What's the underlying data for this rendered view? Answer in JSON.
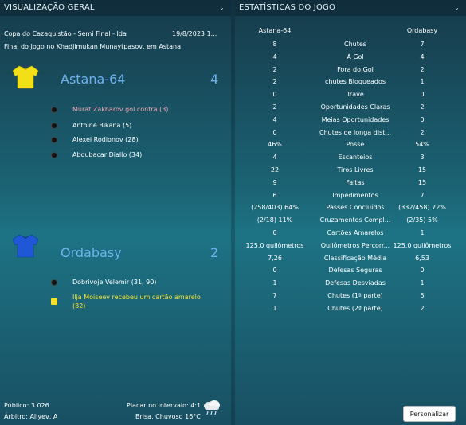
{
  "headers": {
    "overview": "VISUALIZAÇÃO GERAL",
    "stats": "ESTATÍSTICAS DO JOGO"
  },
  "match": {
    "competition": "Copa do Cazaquistão - Semi Final - Ida",
    "date": "19/8/2023 1...",
    "venue": "Final do Jogo no Khadjimukan Munaytpasov, em Astana"
  },
  "home": {
    "name": "Astana-64",
    "score": "4",
    "shirt_color": "#f2df17",
    "events": [
      {
        "type": "own-goal",
        "text": "Murat Zakharov gol contra (3)"
      },
      {
        "type": "goal",
        "text": "Antoine Bikana (5)"
      },
      {
        "type": "goal",
        "text": "Alexei Rodionov (28)"
      },
      {
        "type": "goal",
        "text": "Aboubacar Diallo (34)"
      }
    ]
  },
  "away": {
    "name": "Ordabasy",
    "score": "2",
    "shirt_color": "#1f58d6",
    "events": [
      {
        "type": "goal",
        "text": "Dobrivoje Velemir (31, 90)"
      },
      {
        "type": "yellow-card",
        "text_line1": "Ilja Moiseev recebeu um cartão amarelo",
        "text_line2": "(82)"
      }
    ]
  },
  "stats": {
    "home_label": "Astana-64",
    "away_label": "Ordabasy",
    "rows": [
      {
        "home": "8",
        "label": "Chutes",
        "away": "7"
      },
      {
        "home": "4",
        "label": "A Gol",
        "away": "4"
      },
      {
        "home": "2",
        "label": "Fora do Gol",
        "away": "2"
      },
      {
        "home": "2",
        "label": "chutes Bloqueados",
        "away": "1"
      },
      {
        "home": "0",
        "label": "Trave",
        "away": "0"
      },
      {
        "home": "2",
        "label": "Oportunidades Claras",
        "away": "2"
      },
      {
        "home": "4",
        "label": "Meias Oportunidades",
        "away": "0"
      },
      {
        "home": "0",
        "label": "Chutes de longa dist...",
        "away": "2"
      },
      {
        "home": "46%",
        "label": "Posse",
        "away": "54%"
      },
      {
        "home": "4",
        "label": "Escanteios",
        "away": "3"
      },
      {
        "home": "22",
        "label": "Tiros Livres",
        "away": "15"
      },
      {
        "home": "9",
        "label": "Faltas",
        "away": "15"
      },
      {
        "home": "6",
        "label": "Impedimentos",
        "away": "7"
      },
      {
        "home": "(258/403) 64%",
        "label": "Passes Concluídos",
        "away": "(332/458) 72%"
      },
      {
        "home": "(2/18) 11%",
        "label": "Cruzamentos Compl...",
        "away": "(2/35) 5%"
      },
      {
        "home": "0",
        "label": "Cartões Amarelos",
        "away": "1"
      },
      {
        "home": "125,0 quilômetros",
        "label": "Quilômetros Percorr...",
        "away": "125,0 quilômetros"
      },
      {
        "home": "7,26",
        "label": "Classificação Média",
        "away": "6,53"
      },
      {
        "home": "0",
        "label": "Defesas Seguras",
        "away": "0"
      },
      {
        "home": "1",
        "label": "Defesas Desviadas",
        "away": "1"
      },
      {
        "home": "7",
        "label": "Chutes (1ª parte)",
        "away": "5"
      },
      {
        "home": "1",
        "label": "Chutes (2ª parte)",
        "away": "2"
      }
    ]
  },
  "footer": {
    "attendance": "Público: 3.026",
    "referee": "Árbitro: Aliyev, A",
    "halftime": "Placar no intervalo: 4:1",
    "weather": "Brisa, Chuvoso 16°C",
    "weather_icon": "rain-cloud-icon",
    "customize_label": "Personalizar"
  }
}
